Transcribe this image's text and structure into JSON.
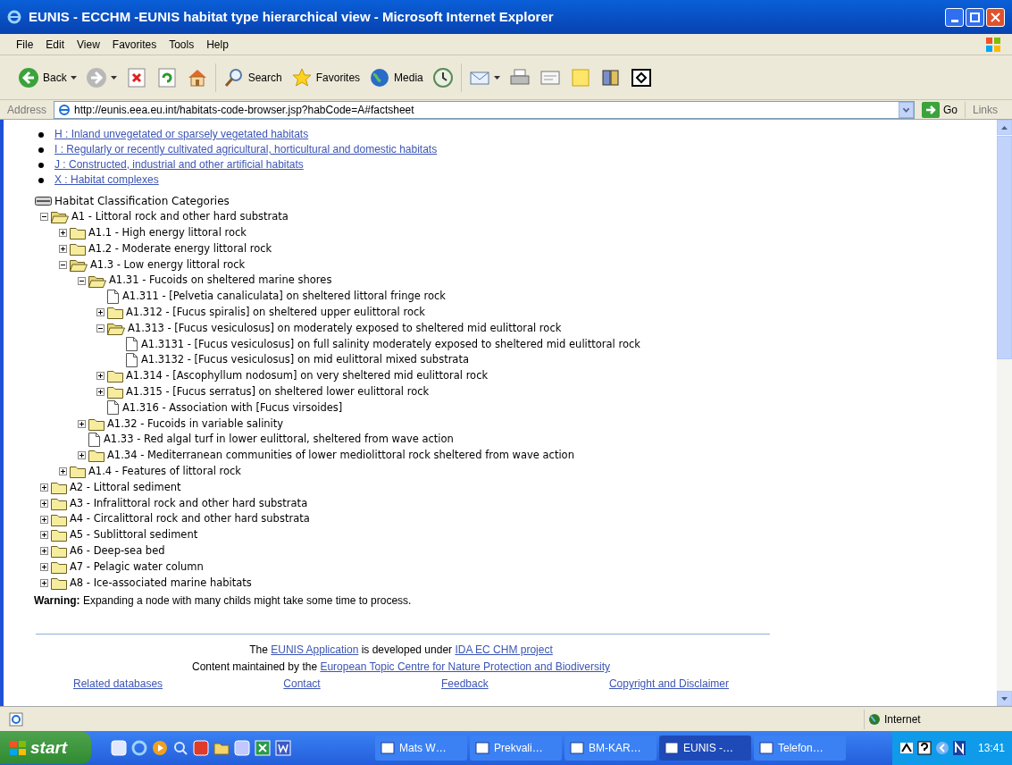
{
  "window": {
    "title": "EUNIS - ECCHM -EUNIS habitat type hierarchical view - Microsoft Internet Explorer"
  },
  "menu": [
    "File",
    "Edit",
    "View",
    "Favorites",
    "Tools",
    "Help"
  ],
  "toolbar": [
    {
      "kind": "back",
      "label": "Back"
    },
    {
      "kind": "forward"
    },
    {
      "kind": "stop"
    },
    {
      "kind": "refresh"
    },
    {
      "kind": "home"
    },
    {
      "kind": "search",
      "label": "Search"
    },
    {
      "kind": "favorites",
      "label": "Favorites"
    },
    {
      "kind": "media",
      "label": "Media"
    },
    {
      "kind": "history"
    },
    {
      "kind": "mail"
    },
    {
      "kind": "print"
    },
    {
      "kind": "edit"
    },
    {
      "kind": "note"
    },
    {
      "kind": "research"
    },
    {
      "kind": "messenger"
    }
  ],
  "address": {
    "label": "Address",
    "value": "http://eunis.eea.eu.int/habitats-code-browser.jsp?habCode=A#factsheet",
    "go": "Go",
    "links": "Links"
  },
  "habitat_links": [
    "H : Inland unvegetated or sparsely vegetated habitats",
    "I : Regularly or recently cultivated agricultural, horticultural and domestic habitats",
    "J : Constructed, industrial and other artificial habitats",
    "X : Habitat complexes"
  ],
  "tree": {
    "title": "Habitat Classification Categories",
    "nodes": [
      {
        "kind": "folder",
        "label": "A1 - Littoral rock and other hard substrata",
        "expanded": true,
        "children": [
          {
            "kind": "folder",
            "label": "A1.1 - High energy littoral rock",
            "expanded": false
          },
          {
            "kind": "folder",
            "label": "A1.2 - Moderate energy littoral rock",
            "expanded": false
          },
          {
            "kind": "folder",
            "label": "A1.3 - Low energy littoral rock",
            "expanded": true,
            "children": [
              {
                "kind": "folder",
                "label": "A1.31 - Fucoids on sheltered marine shores",
                "expanded": true,
                "children": [
                  {
                    "kind": "document",
                    "label": "A1.311 - [Pelvetia canaliculata] on sheltered littoral fringe rock"
                  },
                  {
                    "kind": "folder",
                    "label": "A1.312 - [Fucus spiralis] on sheltered upper eulittoral rock",
                    "expanded": false
                  },
                  {
                    "kind": "folder",
                    "label": "A1.313 - [Fucus vesiculosus] on moderately exposed to sheltered mid eulittoral rock",
                    "expanded": true,
                    "children": [
                      {
                        "kind": "document",
                        "label": "A1.3131 - [Fucus vesiculosus] on full salinity moderately exposed to sheltered mid eulittoral rock"
                      },
                      {
                        "kind": "document",
                        "label": "A1.3132 - [Fucus vesiculosus] on mid eulittoral mixed substrata"
                      }
                    ]
                  },
                  {
                    "kind": "folder",
                    "label": "A1.314 - [Ascophyllum nodosum] on very sheltered mid eulittoral rock",
                    "expanded": false
                  },
                  {
                    "kind": "folder",
                    "label": "A1.315 - [Fucus serratus] on sheltered lower eulittoral rock",
                    "expanded": false
                  },
                  {
                    "kind": "document",
                    "label": "A1.316 - Association with [Fucus virsoides]"
                  }
                ]
              },
              {
                "kind": "folder",
                "label": "A1.32 - Fucoids in variable salinity",
                "expanded": false
              },
              {
                "kind": "document",
                "label": "A1.33 - Red algal turf in lower eulittoral, sheltered from wave action"
              },
              {
                "kind": "folder",
                "label": "A1.34 - Mediterranean communities of lower mediolittoral rock sheltered from wave action",
                "expanded": false
              }
            ]
          },
          {
            "kind": "folder",
            "label": "A1.4 - Features of littoral rock",
            "expanded": false
          }
        ]
      },
      {
        "kind": "folder",
        "label": "A2 - Littoral sediment",
        "expanded": false
      },
      {
        "kind": "folder",
        "label": "A3 - Infralittoral rock and other hard substrata",
        "expanded": false
      },
      {
        "kind": "folder",
        "label": "A4 - Circalittoral rock and other hard substrata",
        "expanded": false
      },
      {
        "kind": "folder",
        "label": "A5 - Sublittoral sediment",
        "expanded": false
      },
      {
        "kind": "folder",
        "label": "A6 - Deep-sea bed",
        "expanded": false
      },
      {
        "kind": "folder",
        "label": "A7 - Pelagic water column",
        "expanded": false
      },
      {
        "kind": "folder",
        "label": "A8 - Ice-associated marine habitats",
        "expanded": false
      }
    ]
  },
  "warning": "**Warning:** Expanding a node with many childs might take some time to process.",
  "footer": {
    "lines": [
      [
        {
          "kind": "text",
          "text": "The "
        },
        {
          "kind": "link",
          "text": "EUNIS Application"
        },
        {
          "kind": "text",
          "text": " is developed under "
        },
        {
          "kind": "link",
          "text": "IDA EC CHM project"
        }
      ],
      [
        {
          "kind": "text",
          "text": "Content maintained by the "
        },
        {
          "kind": "link",
          "text": "European Topic Centre for Nature Protection and Biodiversity"
        }
      ]
    ],
    "links": [
      "Related databases",
      "Contact",
      "Feedback",
      "Copyright and Disclaimer"
    ]
  },
  "status_bar": {
    "zone": "Internet"
  },
  "taskbar": {
    "start": "start",
    "tasks": [
      {
        "label": "Mats W…",
        "selected": false
      },
      {
        "label": "Prekvali…",
        "selected": false
      },
      {
        "label": "BM-KAR…",
        "selected": false
      },
      {
        "label": "EUNIS -…",
        "selected": true
      },
      {
        "label": "Telefon…",
        "selected": false
      }
    ],
    "clock": "13:41"
  }
}
